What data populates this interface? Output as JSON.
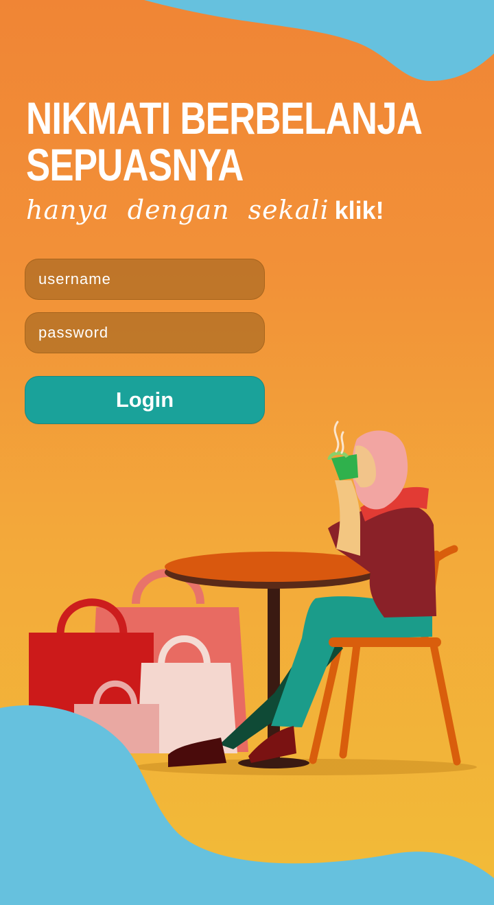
{
  "headline": {
    "line1": "NIKMATI BERBELANJA",
    "line2": "SEPUASNYA"
  },
  "tagline": {
    "script": "hanya dengan sekali",
    "bold": "klik!"
  },
  "form": {
    "username_placeholder": "username",
    "password_placeholder": "password",
    "login_label": "Login"
  },
  "colors": {
    "background_top": "#f08535",
    "background_bottom": "#f2bc38",
    "wave": "#66c1de",
    "button": "#1aa29a",
    "text": "#ffffff"
  },
  "illustration": {
    "icons": [
      "shopping-bag-icon",
      "cafe-table-icon",
      "chair-icon",
      "woman-drinking-coffee-icon",
      "steam-icon"
    ]
  }
}
